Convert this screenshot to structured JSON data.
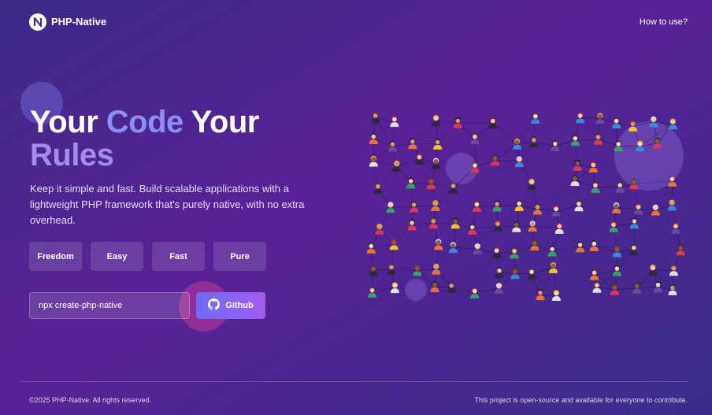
{
  "header": {
    "brand_name": "PHP-Native",
    "nav_link": "How to use?"
  },
  "hero": {
    "title_word1": "Your",
    "title_word2": "Code",
    "title_word3": "Your",
    "title_word4": "Rules",
    "subtitle": "Keep it simple and fast. Build scalable applications with a lightweight PHP framework that's purely native, with no extra overhead."
  },
  "tags": [
    "Freedom",
    "Easy",
    "Fast",
    "Pure"
  ],
  "install": {
    "command": "npx create-php-native",
    "button_label": "Github"
  },
  "footer": {
    "copyright": "©2025 PHP-Native. All rights reserved.",
    "note": "This project is open-source and available for everyone to contribute."
  },
  "colors": {
    "accent_code": "#8e8cf6",
    "accent_rules": "#a48bf0",
    "button_gradient_start": "#6d6cf3",
    "button_gradient_end": "#a45cf0"
  },
  "icons": {
    "logo": "php-native-logo-icon",
    "button": "github-icon"
  }
}
